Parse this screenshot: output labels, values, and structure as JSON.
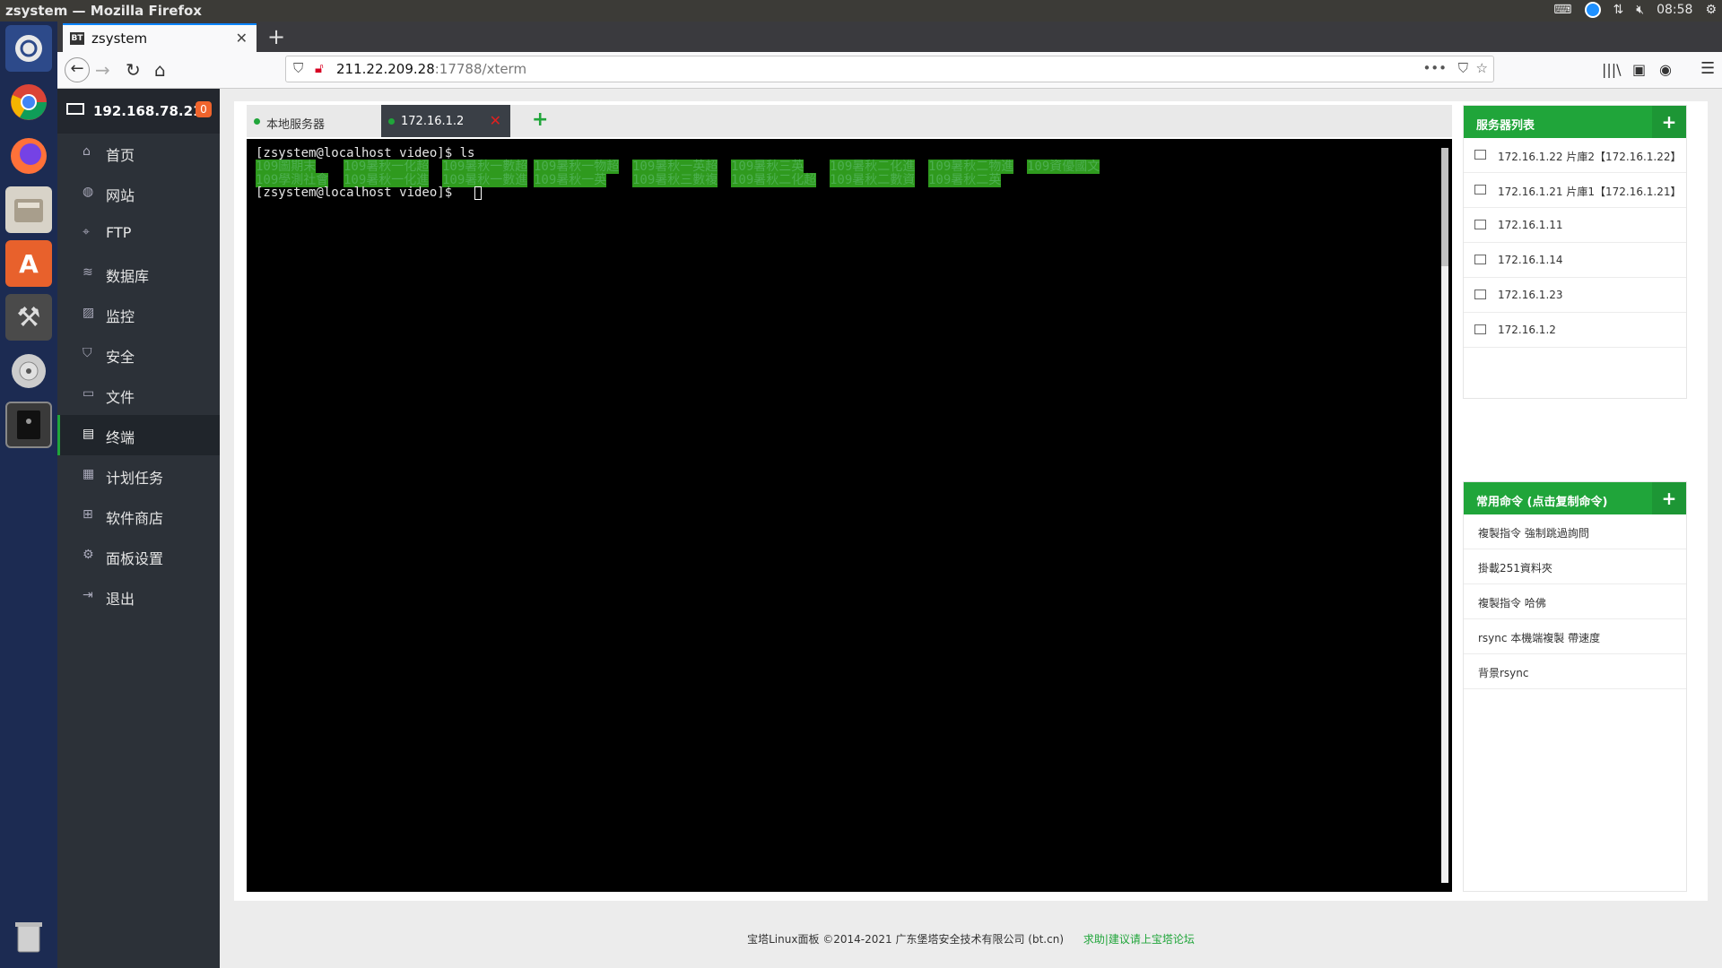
{
  "window": {
    "title": "zsystem — Mozilla Firefox",
    "clock": "08:58"
  },
  "browser": {
    "tab_title": "zsystem",
    "tab_favicon": "BT",
    "url_host": "211.22.209.28",
    "url_rest": ":17788/xterm"
  },
  "sidebar": {
    "ip": "192.168.78.214",
    "badge": "0",
    "items": [
      {
        "label": "首页",
        "icon": "home-icon"
      },
      {
        "label": "网站",
        "icon": "globe-icon"
      },
      {
        "label": "FTP",
        "icon": "ftp-icon"
      },
      {
        "label": "数据库",
        "icon": "database-icon"
      },
      {
        "label": "监控",
        "icon": "monitor-icon"
      },
      {
        "label": "安全",
        "icon": "shield-icon"
      },
      {
        "label": "文件",
        "icon": "folder-icon"
      },
      {
        "label": "终端",
        "icon": "terminal-icon"
      },
      {
        "label": "计划任务",
        "icon": "calendar-icon"
      },
      {
        "label": "软件商店",
        "icon": "apps-icon"
      },
      {
        "label": "面板设置",
        "icon": "gear-icon"
      },
      {
        "label": "退出",
        "icon": "logout-icon"
      }
    ]
  },
  "terminal_tabs": [
    {
      "label": "本地服务器"
    },
    {
      "label": "172.16.1.2"
    }
  ],
  "terminal": {
    "line1": "[zsystem@localhost video]$ ls",
    "line3": "[zsystem@localhost video]$ ",
    "row1": [
      "109圖期末",
      "109暑秋一化超",
      "109暑秋一數超",
      "109暑秋一物超",
      "109暑秋一英超",
      "109暑秋三英",
      "109暑秋二化進",
      "109暑秋二物進",
      "109資優國文"
    ],
    "row2": [
      "109學測社會",
      "109暑秋一化進",
      "109暑秋一數進",
      "109暑秋一英",
      "109暑秋三數複",
      "109暑秋二化超",
      "109暑秋二數資",
      "109暑秋二英"
    ]
  },
  "server_list": {
    "title": "服务器列表",
    "add": "+",
    "items": [
      "172.16.1.22 片庫2【172.16.1.22】",
      "172.16.1.21 片庫1【172.16.1.21】",
      "172.16.1.11",
      "172.16.1.14",
      "172.16.1.23",
      "172.16.1.2"
    ]
  },
  "commands": {
    "title": "常用命令 (点击复制命令)",
    "add": "+",
    "items": [
      "複製指令 強制跳過詢問",
      "掛載251資料夾",
      "複製指令 哈佛",
      "rsync 本機端複製 帶速度",
      "背景rsync"
    ]
  },
  "footer": {
    "copyright": "宝塔Linux面板 ©2014-2021 广东堡塔安全技术有限公司 (bt.cn)",
    "link": "求助|建议请上宝塔论坛"
  }
}
